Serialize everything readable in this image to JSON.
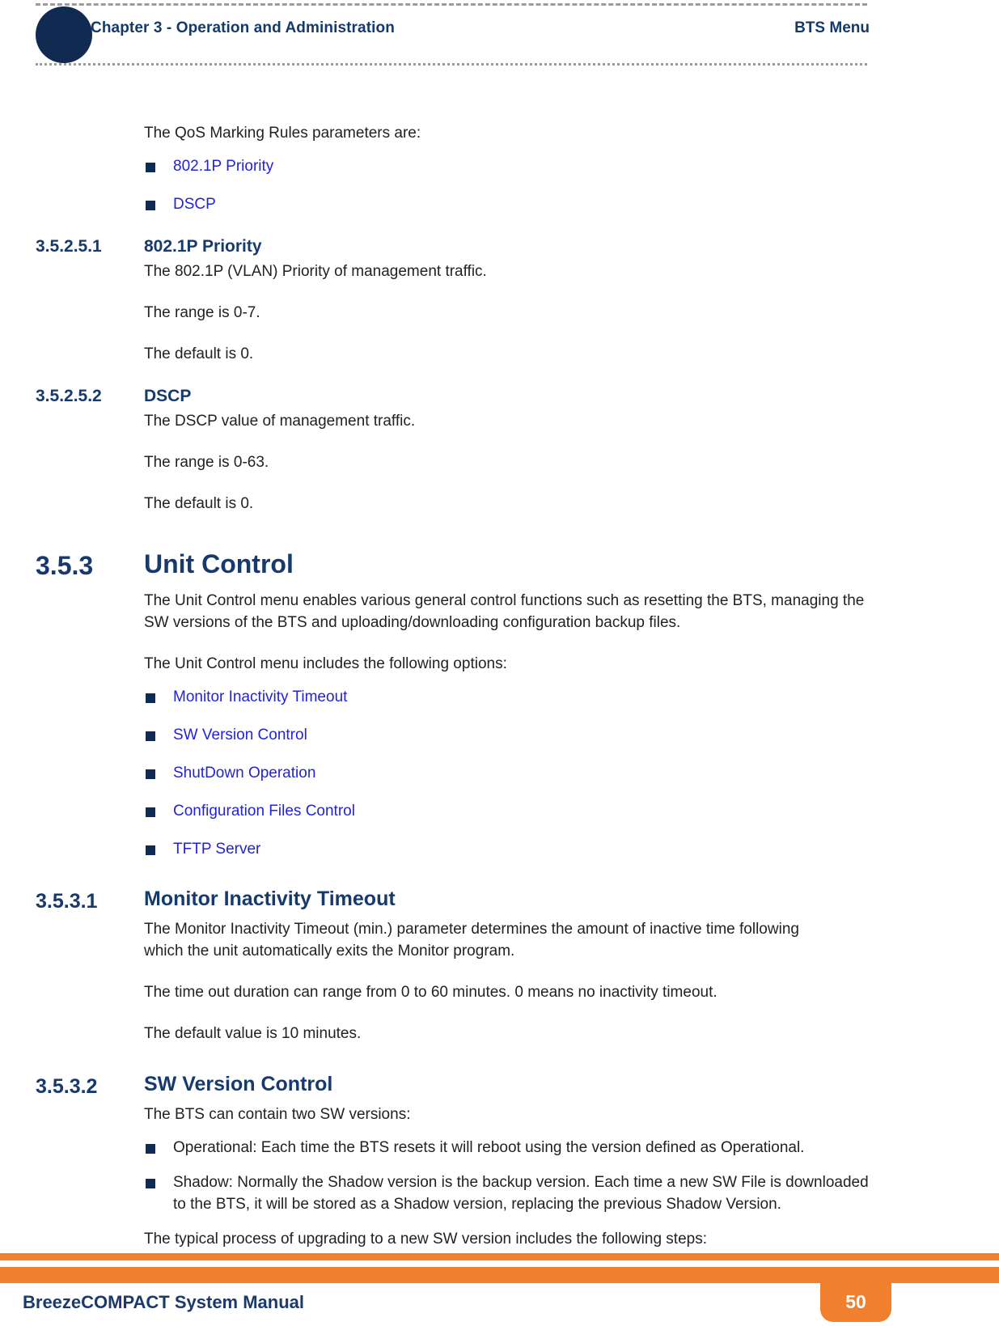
{
  "header": {
    "chapter": "Chapter 3 - Operation and Administration",
    "topic": "BTS Menu"
  },
  "content": {
    "qos_intro": "The QoS Marking Rules parameters are:",
    "qos_links": [
      {
        "label": "802.1P Priority"
      },
      {
        "label": "DSCP"
      }
    ],
    "sections": [
      {
        "number": "3.5.2.5.1",
        "title": "802.1P Priority",
        "paragraphs": [
          "The 802.1P (VLAN) Priority of management traffic.",
          "The range is 0-7.",
          "The default is 0."
        ]
      },
      {
        "number": "3.5.2.5.2",
        "title": "DSCP",
        "paragraphs": [
          "The DSCP value of management traffic.",
          "The range is 0-63.",
          "The default is 0."
        ]
      }
    ],
    "unit_control": {
      "number": "3.5.3",
      "title": "Unit Control",
      "paragraph_1": "The Unit Control menu enables various general control functions such as resetting the BTS, managing the SW versions of the BTS and uploading/downloading configuration backup files.",
      "paragraph_2": "The Unit Control menu includes the following options:",
      "options": [
        {
          "label": "Monitor Inactivity Timeout"
        },
        {
          "label": "SW Version Control"
        },
        {
          "label": "ShutDown Operation"
        },
        {
          "label": "Configuration Files Control"
        },
        {
          "label": "TFTP Server"
        }
      ]
    },
    "monitor_inactivity": {
      "number": "3.5.3.1",
      "title": "Monitor Inactivity Timeout",
      "paragraphs": [
        "The Monitor Inactivity Timeout (min.) parameter determines the amount of inactive time following which the unit automatically exits the Monitor program.",
        "The time out duration can range from 0 to 60 minutes. 0 means no inactivity timeout.",
        "The default value is 10 minutes."
      ]
    },
    "sw_version_control": {
      "number": "3.5.3.2",
      "title": "SW Version Control",
      "intro": "The BTS can contain two SW versions:",
      "versions": [
        {
          "text": "Operational: Each time the BTS resets it will reboot using the version defined as Operational."
        },
        {
          "text": "Shadow: Normally the Shadow version is the backup version. Each time a new SW File is downloaded to the BTS, it will be stored as a Shadow version, replacing the previous Shadow Version."
        }
      ],
      "outro": "The typical process of upgrading to a new SW version includes the following steps:"
    }
  },
  "footer": {
    "title": "BreezeCOMPACT System Manual",
    "page_number": "50"
  },
  "colors": {
    "heading_navy": "#173a6d",
    "link_blue": "#2323d6",
    "accent_orange": "#f0802d",
    "dot_navy": "#102a52"
  }
}
